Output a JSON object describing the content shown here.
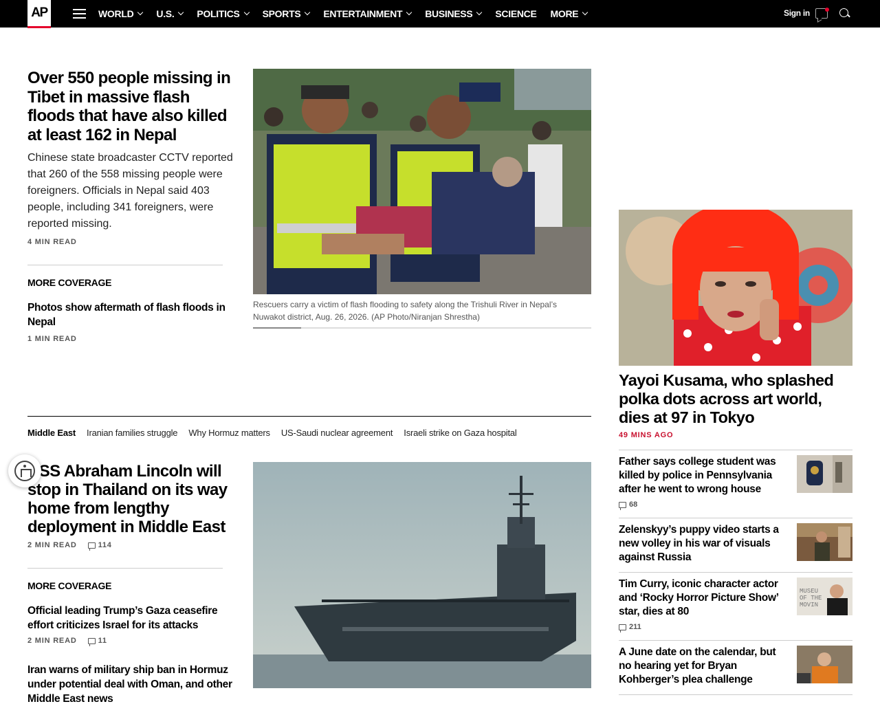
{
  "header": {
    "logo": "AP",
    "nav": [
      {
        "label": "WORLD",
        "dropdown": true
      },
      {
        "label": "U.S.",
        "dropdown": true
      },
      {
        "label": "POLITICS",
        "dropdown": true
      },
      {
        "label": "SPORTS",
        "dropdown": true
      },
      {
        "label": "ENTERTAINMENT",
        "dropdown": true
      },
      {
        "label": "BUSINESS",
        "dropdown": true
      },
      {
        "label": "SCIENCE",
        "dropdown": false
      },
      {
        "label": "MORE",
        "dropdown": true
      }
    ],
    "signin": "Sign in",
    "accent": "#e4002b"
  },
  "lead": {
    "headline": "Over 550 people missing in Tibet in massive flash floods that have also killed at least 162 in Nepal",
    "summary": "Chinese state broadcaster CCTV reported that 260 of the 558 missing people were foreigners. Officials in Nepal said 403 people, including 341 foreigners, were reported missing.",
    "read_time": "4 MIN READ",
    "more_coverage_label": "MORE COVERAGE",
    "related": {
      "headline": "Photos show aftermath of flash floods in Nepal",
      "read_time": "1 MIN READ"
    },
    "photo_caption": "Rescuers carry a victim of flash flooding to safety along the Trishuli River in Nepal’s Nuwakot district, Aug. 26, 2026. (AP Photo/Niranjan Shrestha)"
  },
  "middle_east": {
    "section_label": "Middle East",
    "tabs": [
      "Iranian families struggle",
      "Why Hormuz matters",
      "US-Saudi nuclear agreement",
      "Israeli strike on Gaza hospital"
    ],
    "headline": "USS Abraham Lincoln will stop in Thailand on its way home from lengthy deployment in Middle East",
    "read_time": "2 MIN READ",
    "comments": "114",
    "more_coverage_label": "MORE COVERAGE",
    "related": [
      {
        "headline": "Official leading Trump’s Gaza ceasefire effort criticizes Israel for its attacks",
        "read_time": "2 MIN READ",
        "comments": "11"
      },
      {
        "headline": "Iran warns of military ship ban in Hormuz under potential deal with Oman, and other Middle East news"
      }
    ]
  },
  "rail": {
    "feature": {
      "headline": "Yayoi Kusama, who splashed polka dots across art world, dies at 97 in Tokyo",
      "time": "49 MINS AGO"
    },
    "items": [
      {
        "title": "Father says college student was killed by police in Pennsylvania after he went to wrong house",
        "comments": "68"
      },
      {
        "title": "Zelenskyy’s puppy video starts a new volley in his war of visuals against Russia"
      },
      {
        "title": "Tim Curry, iconic character actor and ‘Rocky Horror Picture Show’ star, dies at 80",
        "comments": "211"
      },
      {
        "title": "A June date on the calendar, but no hearing yet for Bryan Kohberger’s plea challenge"
      }
    ]
  }
}
